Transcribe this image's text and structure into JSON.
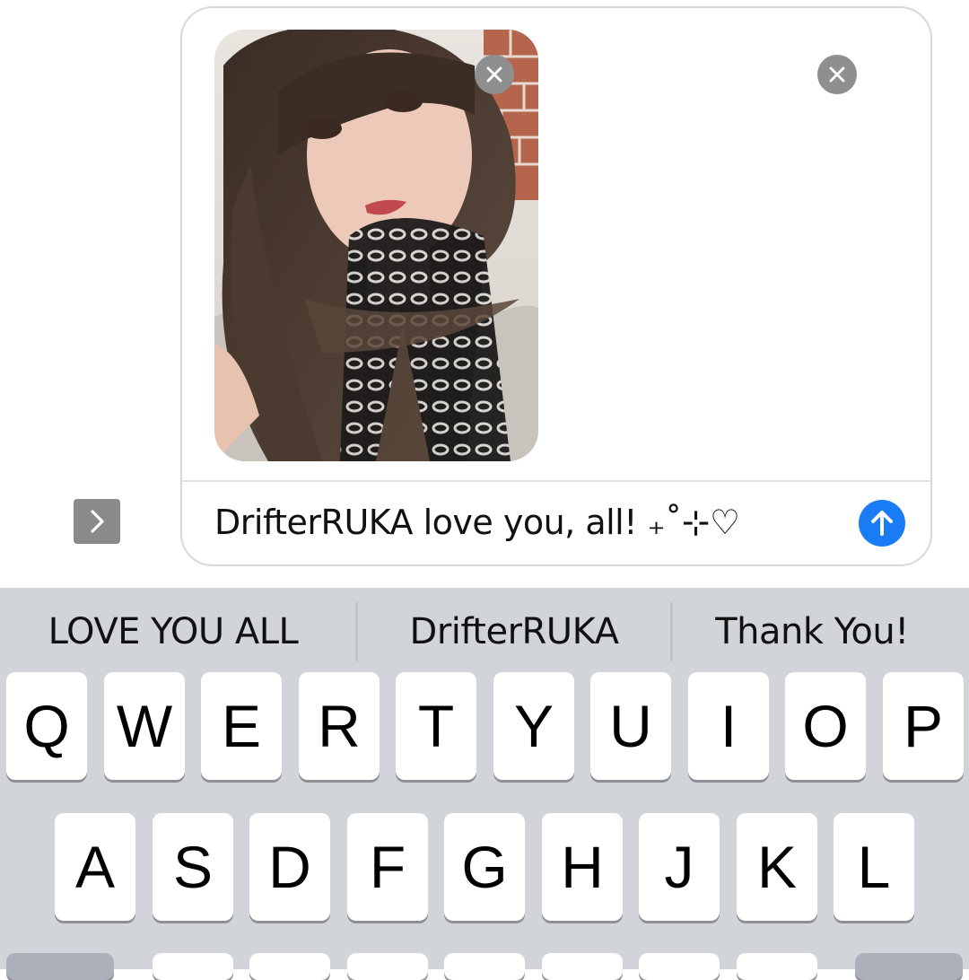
{
  "compose": {
    "message_text": "DrifterRUKA love you, all! ₊˚⊹♡",
    "attachment": {
      "label": ""
    }
  },
  "suggestions": [
    "LOVE YOU ALL",
    "DrifterRUKA",
    "Thank You!"
  ],
  "keyboard": {
    "row1": [
      "Q",
      "W",
      "E",
      "R",
      "T",
      "Y",
      "U",
      "I",
      "O",
      "P"
    ],
    "row2": [
      "A",
      "S",
      "D",
      "F",
      "G",
      "H",
      "J",
      "K",
      "L"
    ]
  },
  "colors": {
    "send_button": "#1a7cf5",
    "keyboard_bg": "#d1d4d9",
    "remove_button": "#8f8f8f"
  }
}
